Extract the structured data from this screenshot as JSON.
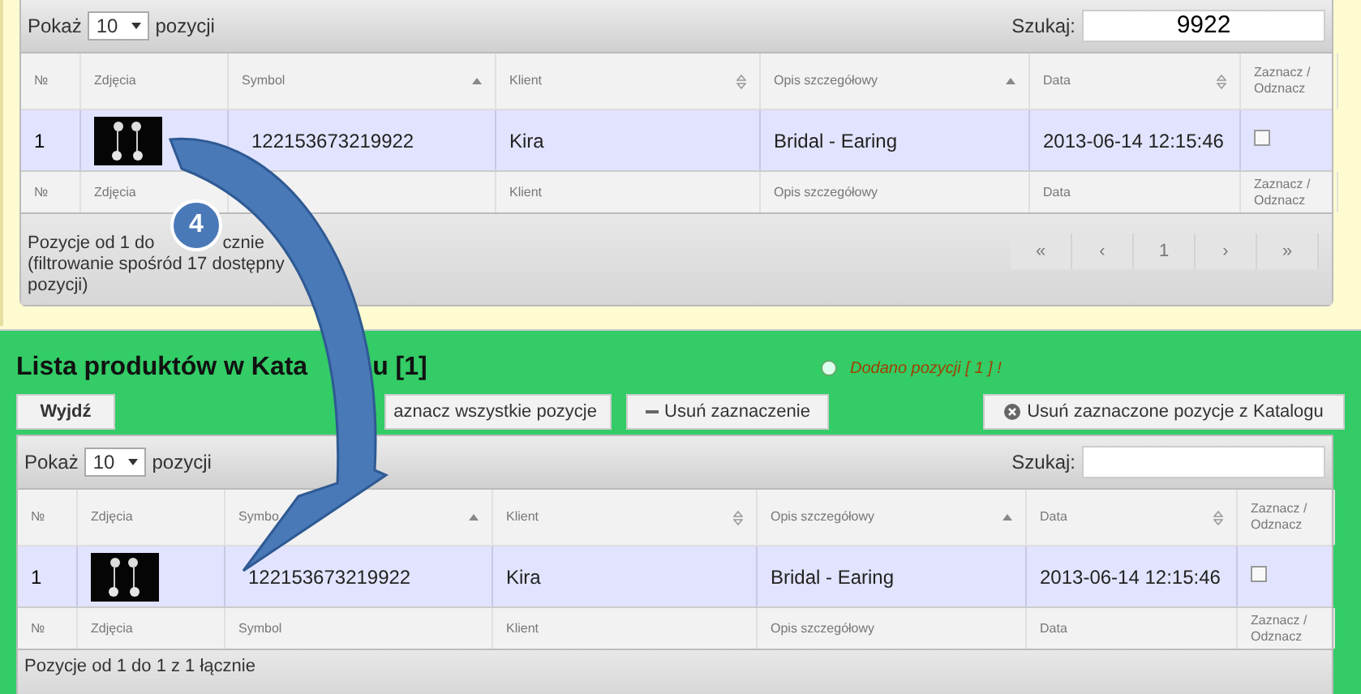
{
  "search_panel": {
    "length": {
      "label_before": "Pokaż",
      "value": "10",
      "label_after": "pozycji"
    },
    "search": {
      "label": "Szukaj:",
      "value": "9922"
    },
    "columns": [
      "№",
      "Zdjęcia",
      "Symbol",
      "Klient",
      "Opis szczegółowy",
      "Data",
      "Zaznacz / Odznacz"
    ],
    "rows": [
      {
        "number": "1",
        "symbol": "122153673219922",
        "client": "Kira",
        "description": "Bridal - Earing",
        "date": "2013-06-14 12:15:46",
        "checked": false
      }
    ],
    "footer_columns": [
      "№",
      "Zdjęcia",
      null,
      "Klient",
      "Opis szczegółowy",
      "Data",
      "Zaznacz / Odznacz"
    ],
    "info_lines": [
      [
        "Pozycje od 1 do",
        "cznie"
      ],
      [
        "(filtrowanie spośród 17 dostępny"
      ],
      [
        "pozycji)"
      ]
    ],
    "pagination": [
      "«",
      "‹",
      "1",
      "›",
      "»"
    ]
  },
  "catalog": {
    "title": [
      "Lista produktów w Kata",
      "u [1]"
    ],
    "message": "Dodano pozycji [ 1 ] !",
    "buttons": [
      "Wyjdź",
      "aznacz wszystkie pozycje",
      "Usuń zaznaczenie",
      "Usuń zaznaczone pozycje z Katalogu"
    ],
    "length": {
      "label_before": "Pokaż",
      "value": "10",
      "label_after": "pozycji"
    },
    "search": {
      "label": "Szukaj:"
    },
    "columns": [
      "№",
      "Zdjęcia",
      "Symbo",
      "Klient",
      "Opis szczegółowy",
      "Data",
      "Zaznacz / Odznacz"
    ],
    "rows": [
      {
        "number": "1",
        "symbol": "122153673219922",
        "client": "Kira",
        "description": "Bridal - Earing",
        "date": "2013-06-14 12:15:46",
        "checked": false
      }
    ],
    "footer_columns": [
      "№",
      "Zdjęcia",
      "Symbol",
      "Klient",
      "Opis szczegółowy",
      "Data",
      "Zaznacz / Odznacz"
    ],
    "info_lines": [
      [
        "Pozycje od 1 do 1 z 1 łącznie"
      ]
    ]
  },
  "annotation": {
    "label": "4"
  }
}
